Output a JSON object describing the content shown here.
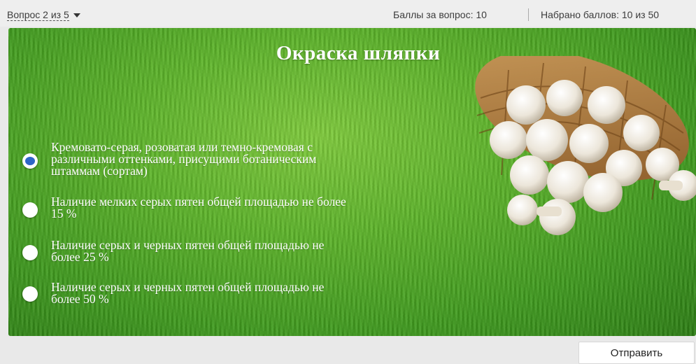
{
  "header": {
    "question_nav": "Вопрос 2 из 5",
    "score_per_question": "Баллы за вопрос: 10",
    "total_score": "Набрано баллов: 10 из 50"
  },
  "slide": {
    "title": "Окраска шляпки",
    "image": "mushroom-basket-icon",
    "options": [
      {
        "lines": [
          "Кремовато-серая, розоватая или темно-кремовая с",
          "различными оттенками, присущими ботаническим",
          "штаммам (сортам)"
        ],
        "checked": true
      },
      {
        "lines": [
          "Наличие мелких серых пятен общей площадью не более",
          "15 %"
        ],
        "checked": false
      },
      {
        "lines": [
          "Наличие серых и черных пятен общей площадью не",
          "более 25 %"
        ],
        "checked": false
      },
      {
        "lines": [
          "Наличие серых и черных пятен общей площадью не",
          "более 50 %"
        ],
        "checked": false
      }
    ]
  },
  "footer": {
    "submit_label": "Отправить"
  },
  "colors": {
    "accent": "#2e66c7",
    "grass": "#5db42a"
  }
}
